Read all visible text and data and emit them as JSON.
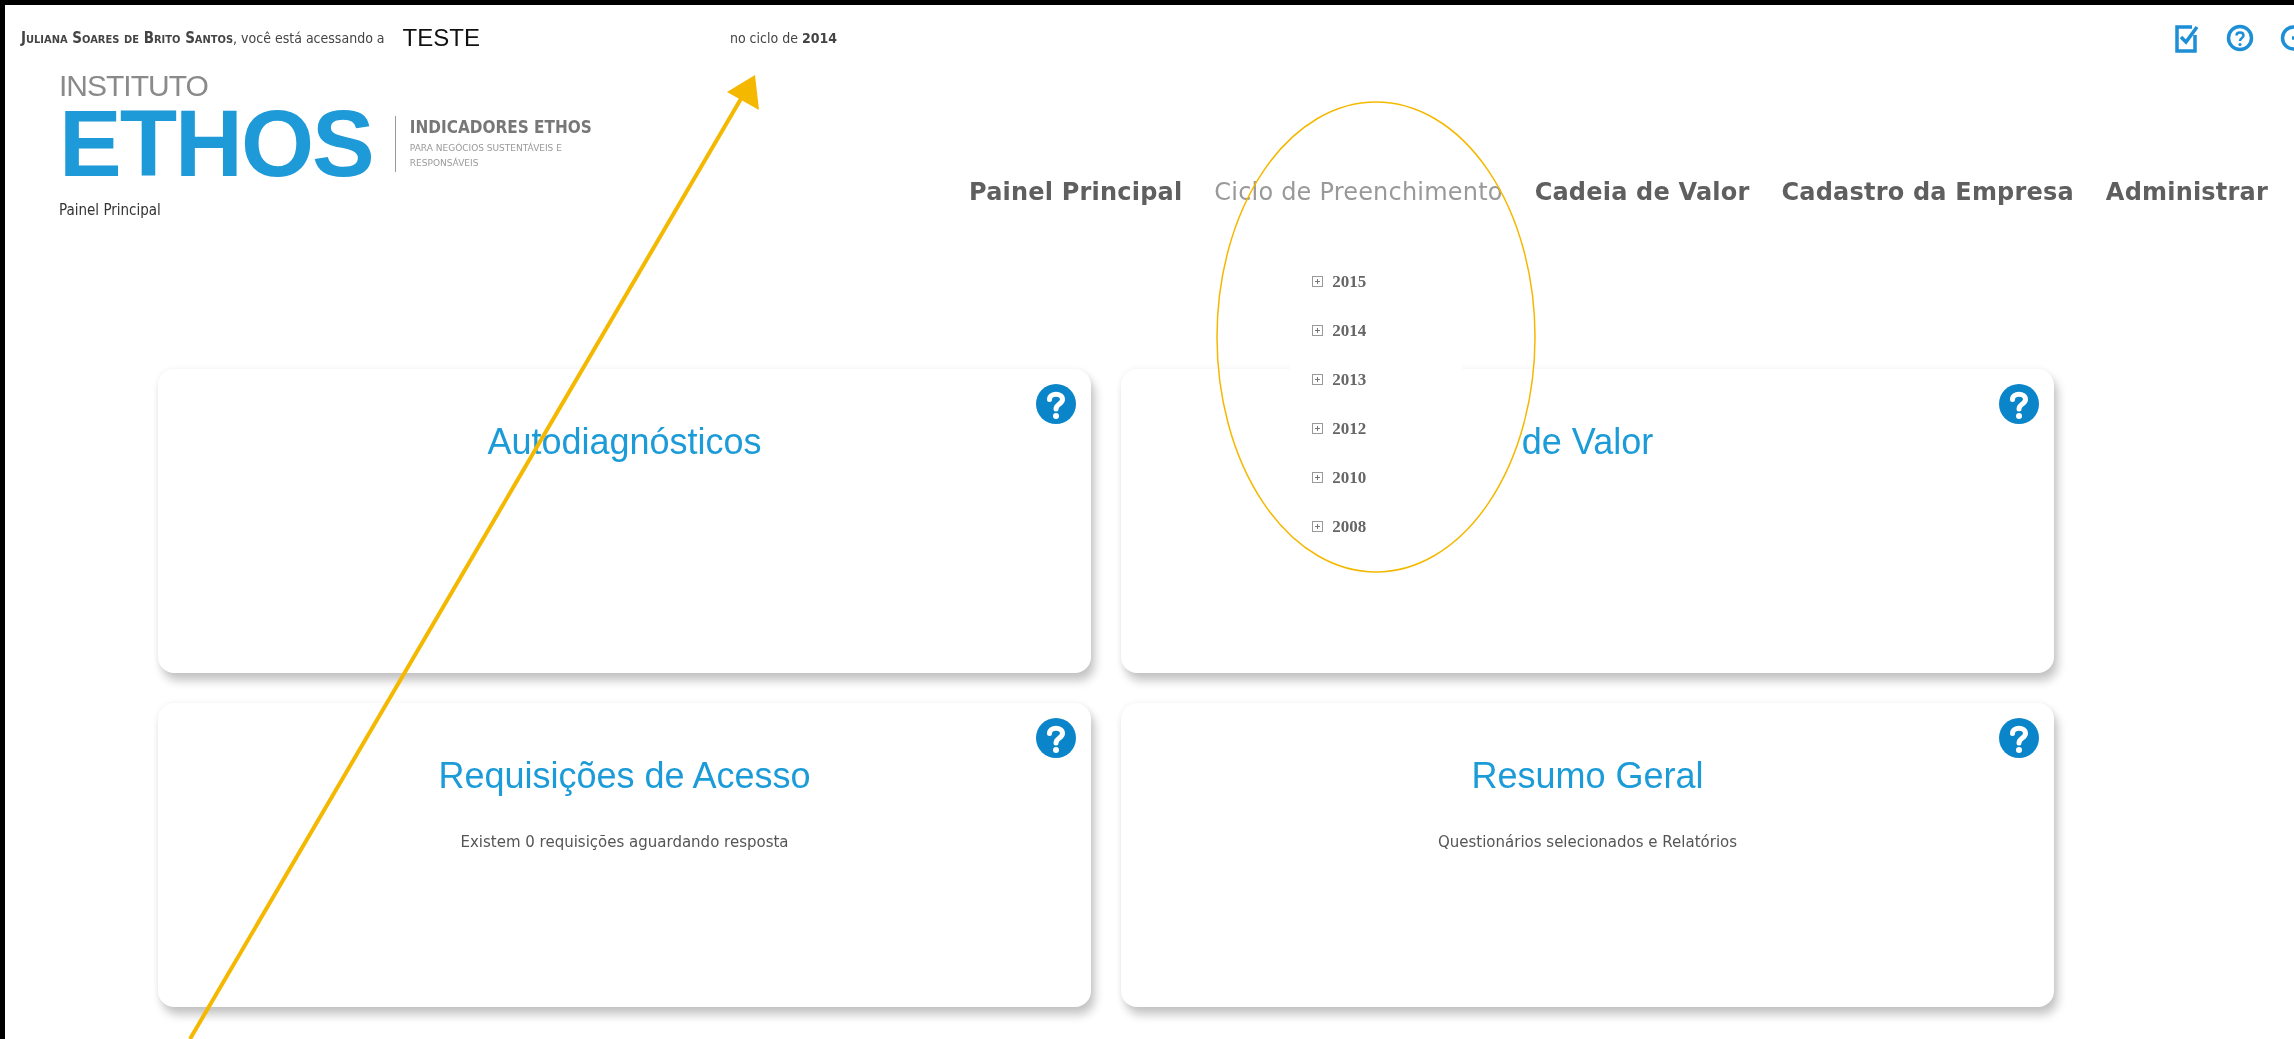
{
  "top_bar": {
    "user": "Juliana Soares de Brito Santos",
    "access_text": ", você está acessando a",
    "organization": "TESTE",
    "cycle_text": "no ciclo de **2014**"
  },
  "logo": {
    "overline": "INSTITUTO",
    "wordmark": "ETHOS",
    "title": "INDICADORES ETHOS",
    "subtitle": "PARA NEGÓCIOS SUSTENTÁVEIS E RESPONSÁVEIS"
  },
  "breadcrumb": "Painel Principal",
  "nav": [
    {
      "label": "Painel Principal",
      "selected": false
    },
    {
      "label": "Ciclo de Preenchimento",
      "selected": true,
      "menu": [
        "2015",
        "2014",
        "2013",
        "2012",
        "2010",
        "2008"
      ]
    },
    {
      "label": "Cadeia de Valor",
      "selected": false
    },
    {
      "label": "Cadastro da Empresa",
      "selected": false
    },
    {
      "label": "Administrar",
      "selected": false
    }
  ],
  "cards": [
    {
      "title": "Autodiagnósticos"
    },
    {
      "title": "de Valor"
    },
    {
      "title": "Requisições de Acesso",
      "description": "Existem 0 requisições aguardando resposta"
    },
    {
      "title": "Resumo Geral",
      "description": "Questionários selecionados e Relatórios"
    }
  ]
}
